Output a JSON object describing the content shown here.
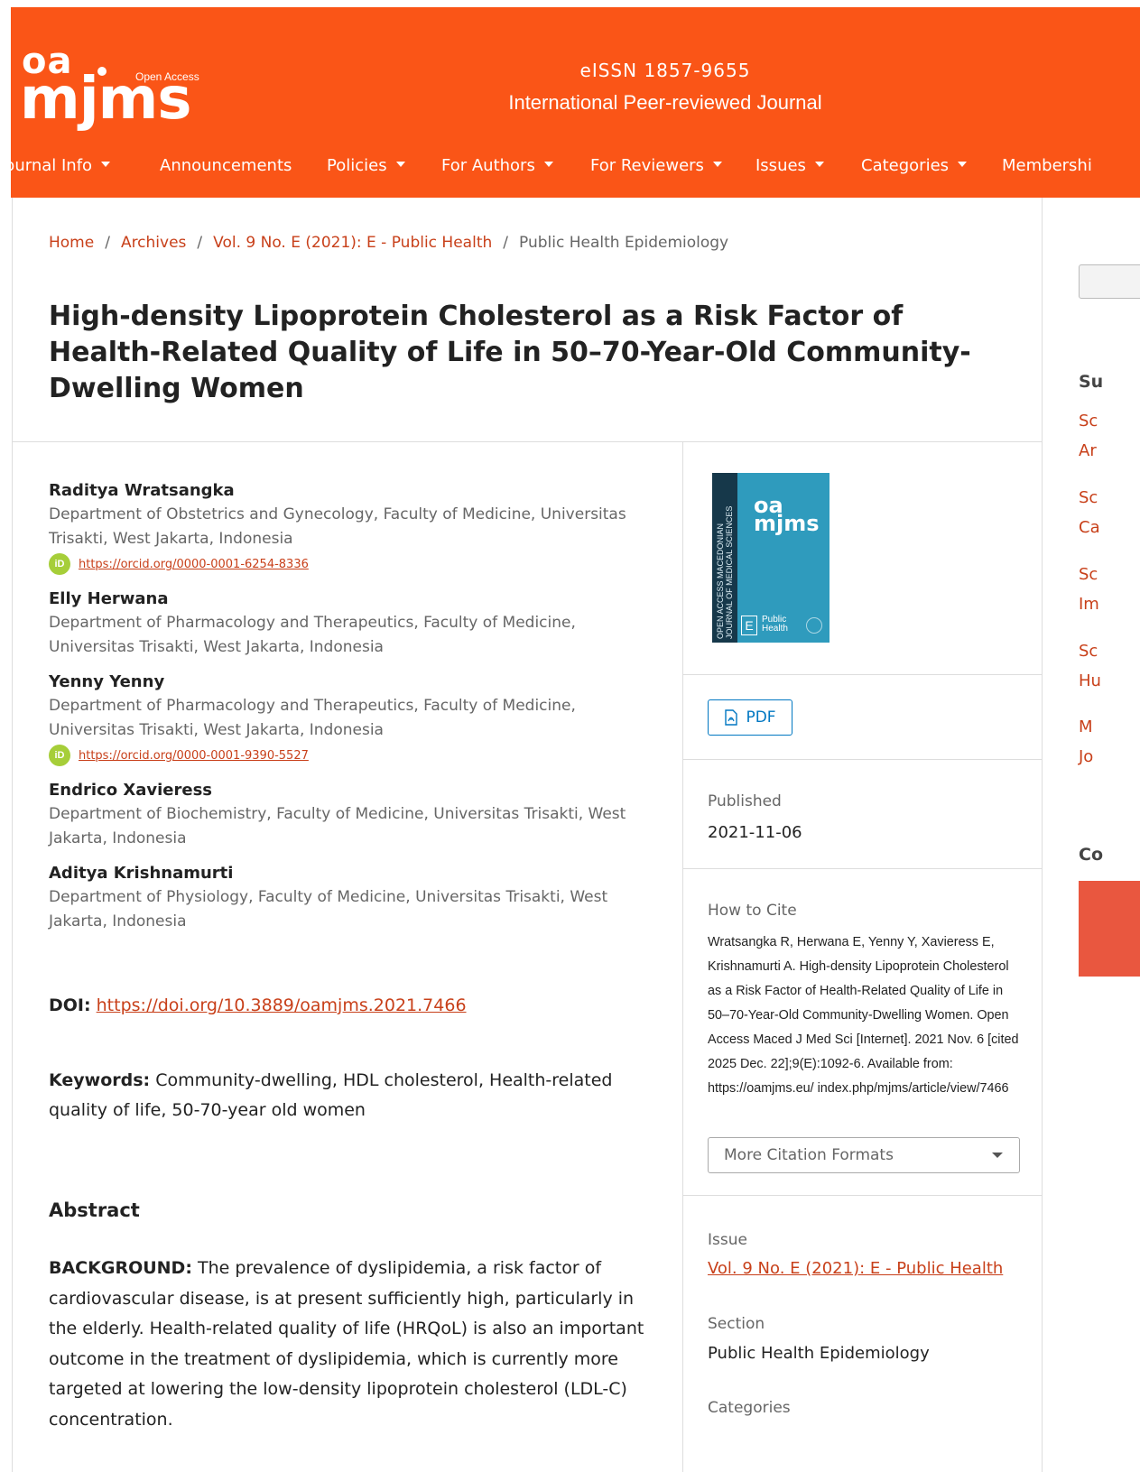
{
  "header": {
    "logo_oa": "oa",
    "logo_open_access": "Open Access",
    "logo_mjms": "mjms",
    "issn": "eISSN 1857-9655",
    "subtitle": "International Peer-reviewed Journal",
    "brand_color": "#fa5517"
  },
  "nav": {
    "items": [
      {
        "label": "Journal Info",
        "dropdown": true
      },
      {
        "label": "Announcements",
        "dropdown": false
      },
      {
        "label": "Policies",
        "dropdown": true
      },
      {
        "label": "For Authors",
        "dropdown": true
      },
      {
        "label": "For Reviewers",
        "dropdown": true
      },
      {
        "label": "Issues",
        "dropdown": true
      },
      {
        "label": "Categories",
        "dropdown": true
      },
      {
        "label": "Membershi",
        "dropdown": false
      }
    ]
  },
  "breadcrumb": {
    "home": "Home",
    "archives": "Archives",
    "issue": "Vol. 9 No. E (2021): E - Public Health",
    "current": "Public Health Epidemiology",
    "separator": "/"
  },
  "article": {
    "title": "High-density Lipoprotein Cholesterol as a Risk Factor of Health-Related Quality of Life in 50–70-Year-Old Community-Dwelling Women",
    "authors": [
      {
        "name": "Raditya Wratsangka",
        "affiliation": "Department of Obstetrics and Gynecology, Faculty of Medicine, Universitas Trisakti, West Jakarta, Indonesia",
        "orcid": "https://orcid.org/0000-0001-6254-8336"
      },
      {
        "name": "Elly Herwana",
        "affiliation": "Department of Pharmacology and Therapeutics, Faculty of Medicine, Universitas Trisakti, West Jakarta, Indonesia",
        "orcid": ""
      },
      {
        "name": "Yenny Yenny",
        "affiliation": "Department of Pharmacology and Therapeutics, Faculty of Medicine, Universitas Trisakti, West Jakarta, Indonesia",
        "orcid": "https://orcid.org/0000-0001-9390-5527"
      },
      {
        "name": "Endrico Xavieress",
        "affiliation": "Department of Biochemistry, Faculty of Medicine, Universitas Trisakti, West Jakarta, Indonesia",
        "orcid": ""
      },
      {
        "name": "Aditya Krishnamurti",
        "affiliation": "Department of Physiology, Faculty of Medicine, Universitas Trisakti, West Jakarta, Indonesia",
        "orcid": ""
      }
    ],
    "orcid_icon_text": "iD",
    "doi_label": "DOI:",
    "doi": "https://doi.org/10.3889/oamjms.2021.7466",
    "keywords_label": "Keywords:",
    "keywords": "Community-dwelling, HDL cholesterol, Health-related quality of life, 50-70-year old women",
    "abstract_heading": "Abstract",
    "abstract_label": "BACKGROUND:",
    "abstract_text": "The prevalence of dyslipidemia, a risk factor of cardiovascular disease, is at present sufficiently high, particularly in the elderly. Health-related quality of life (HRQoL) is also an important outcome in the treatment of dyslipidemia, which is currently more targeted at lowering the low-density lipoprotein cholesterol (LDL-C) concentration."
  },
  "cover": {
    "strip_text_1": "OPEN ACCESS MACEDONIAN",
    "strip_text_2": "JOURNAL OF MEDICAL SCIENCES",
    "logo_oa": "oa",
    "logo_mjms": "mjms",
    "section_letter": "E",
    "section_name_1": "Public",
    "section_name_2": "Health"
  },
  "side": {
    "pdf_label": "PDF",
    "published_label": "Published",
    "published_date": "2021-11-06",
    "cite_label": "How to Cite",
    "cite_text": "Wratsangka R, Herwana E, Yenny Y, Xavieress E, Krishnamurti A. High-density Lipoprotein Cholesterol as a Risk Factor of Health-Related Quality of Life in 50–70-Year-Old Community-Dwelling Women. Open Access Maced J Med Sci [Internet]. 2021 Nov. 6 [cited 2025 Dec. 22];9(E):1092-6. Available from: https://oamjms.eu/ index.php/mjms/article/view/7466",
    "cite_select": "More Citation Formats",
    "issue_label": "Issue",
    "issue_link": "Vol. 9 No. E (2021): E - Public Health",
    "section_label": "Section",
    "section_value": "Public Health Epidemiology",
    "categories_label": "Categories"
  },
  "right_sidebar": {
    "heading_1": "Su",
    "links": [
      "Sc",
      "Ar",
      "Sc",
      "Ca",
      "Sc",
      "Im",
      "Sc",
      "Hu",
      "M",
      "Jo"
    ],
    "heading_2": "Co"
  },
  "colors": {
    "link": "#c8401a",
    "pdf_button": "#0077c2",
    "orcid": "#a6ce39"
  }
}
